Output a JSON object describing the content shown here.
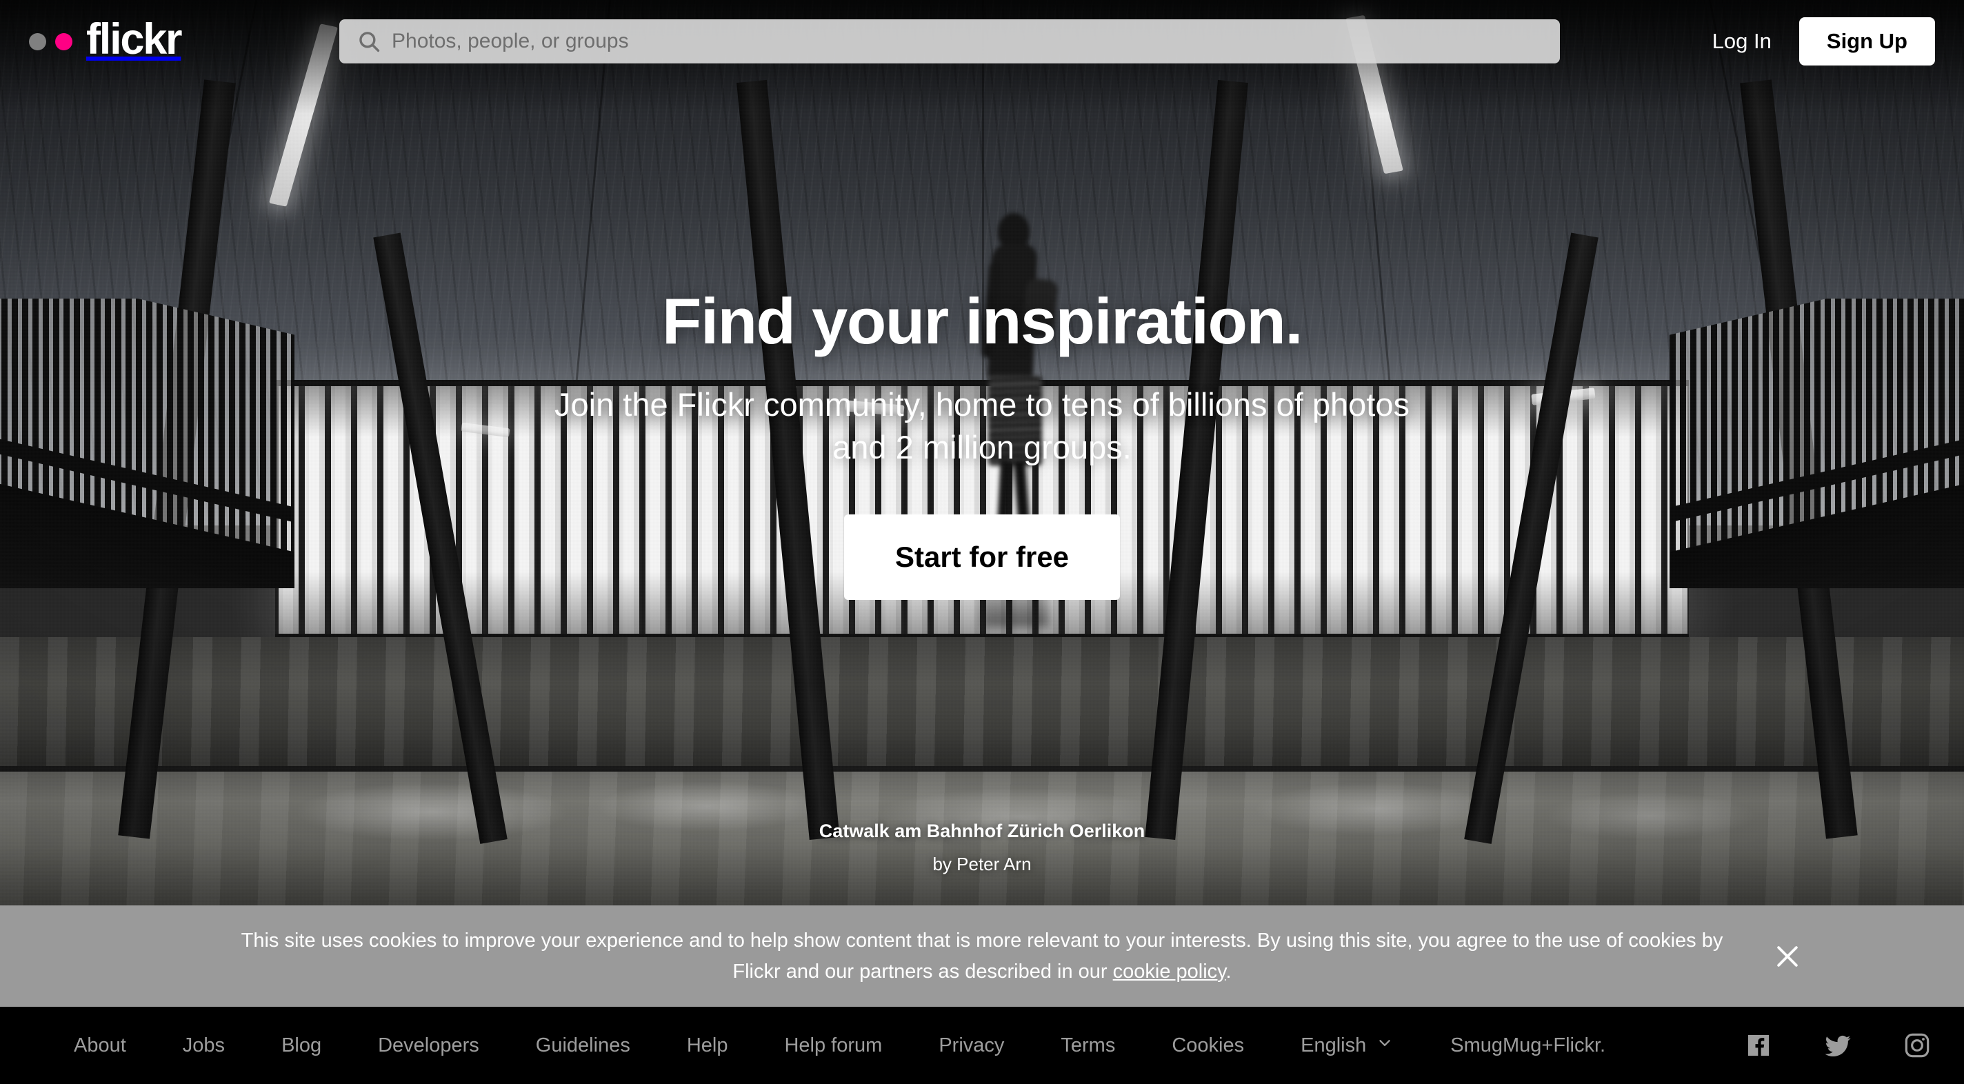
{
  "header": {
    "logo": {
      "word": "flickr",
      "dot1_color": "#808080",
      "dot2_color": "#ff0084"
    },
    "search": {
      "placeholder": "Photos, people, or groups",
      "value": "",
      "icon": "search-icon"
    },
    "login_label": "Log In",
    "signup_label": "Sign Up"
  },
  "hero": {
    "title": "Find your inspiration.",
    "subtitle": "Join the Flickr community, home to tens of billions of photos and 2 million groups.",
    "cta_label": "Start for free",
    "photo_title": "Catwalk am Bahnhof Zürich Oerlikon",
    "photo_author": "by Peter Arn"
  },
  "cookie_banner": {
    "text_before": "This site uses cookies to improve your experience and to help show content that is more relevant to your interests. By using this site, you agree to the use of cookies by Flickr and our partners as described in our ",
    "link_label": "cookie policy",
    "text_after": ".",
    "close_icon": "close-icon",
    "background_color": "#9a9a9a"
  },
  "footer": {
    "links": [
      {
        "label": "About"
      },
      {
        "label": "Jobs"
      },
      {
        "label": "Blog"
      },
      {
        "label": "Developers"
      },
      {
        "label": "Guidelines"
      },
      {
        "label": "Help"
      },
      {
        "label": "Help forum"
      },
      {
        "label": "Privacy"
      },
      {
        "label": "Terms"
      },
      {
        "label": "Cookies"
      }
    ],
    "language": {
      "label": "English",
      "chevron_icon": "chevron-down-icon"
    },
    "smugmug_label": "SmugMug+Flickr.",
    "social": [
      {
        "name": "facebook-icon"
      },
      {
        "name": "twitter-icon"
      },
      {
        "name": "instagram-icon"
      }
    ],
    "link_color": "#9d9d9d"
  }
}
